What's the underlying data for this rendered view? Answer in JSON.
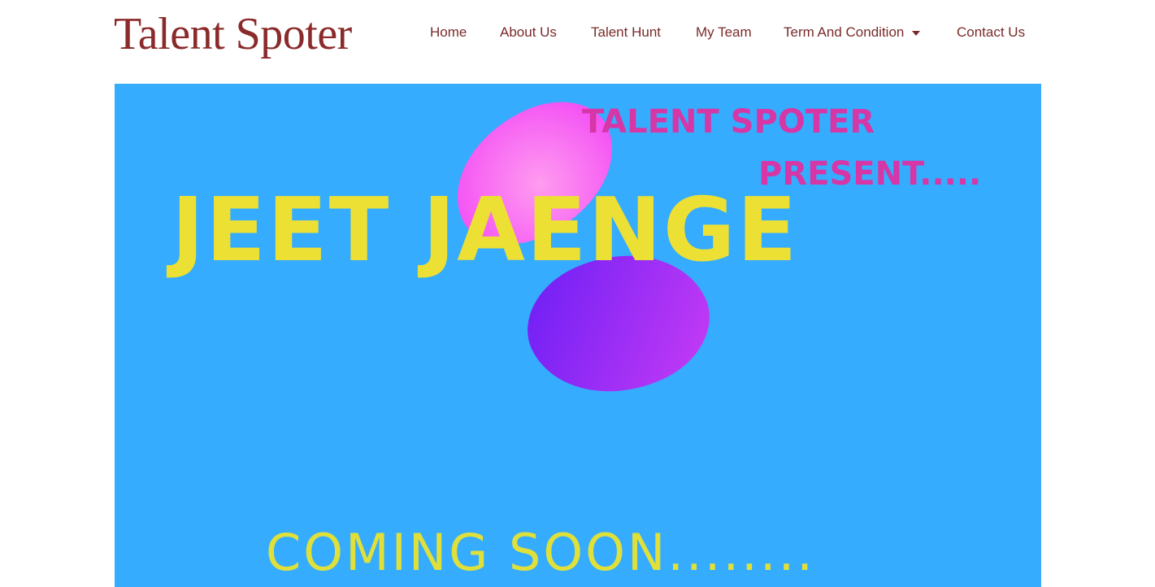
{
  "header": {
    "logo": "Talent Spoter",
    "nav": [
      "Home",
      "About Us",
      "Talent Hunt",
      "My Team",
      "Term And Condition",
      "Contact Us"
    ]
  },
  "banner": {
    "line1": "TALENT SPOTER",
    "line2": "PRESENT.....",
    "title": "JEET JAENGE",
    "footer": "COMING SOON........"
  },
  "colors": {
    "brand": "#8b2a2a",
    "banner_bg": "#35acfd",
    "title": "#ede034",
    "accent": "#d636a6"
  }
}
